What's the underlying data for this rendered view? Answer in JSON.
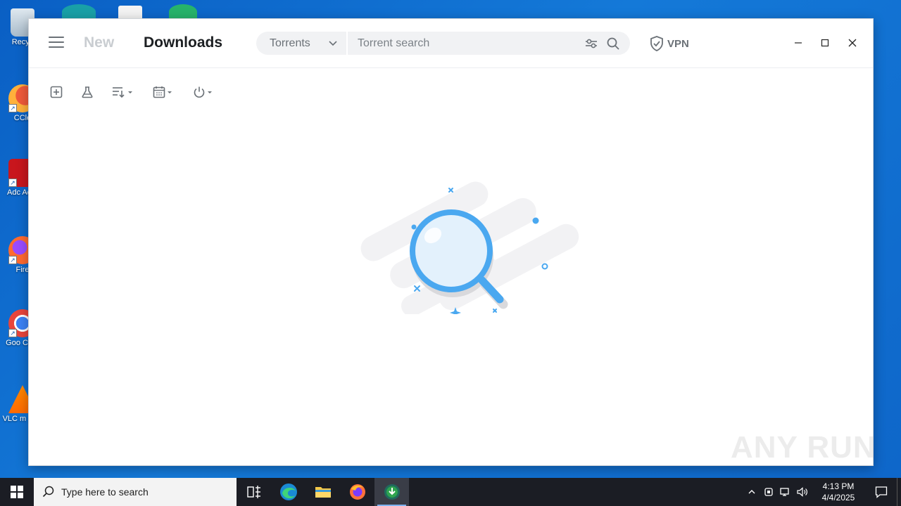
{
  "desktop": {
    "icons": [
      {
        "label": "Recyc",
        "name": "recycle-bin"
      },
      {
        "label": "CCle",
        "name": "ccleaner"
      },
      {
        "label": "Adc Acro",
        "name": "adobe-acrobat"
      },
      {
        "label": "Fire",
        "name": "firefox"
      },
      {
        "label": "Goo Chro",
        "name": "google-chrome"
      },
      {
        "label": "VLC m play",
        "name": "vlc-media-player"
      }
    ]
  },
  "app": {
    "nav": {
      "tab_new": "New",
      "tab_downloads": "Downloads"
    },
    "search": {
      "type_label": "Torrents",
      "placeholder": "Torrent search"
    },
    "vpn_label": "VPN"
  },
  "watermark": "ANY RUN",
  "taskbar": {
    "search_placeholder": "Type here to search",
    "clock_time": "4:13 PM",
    "clock_date": "4/4/2025"
  },
  "colors": {
    "accent": "#4aa8f0",
    "desktop_bg": "#0f6fd0",
    "taskbar_bg": "#1b1d24"
  }
}
